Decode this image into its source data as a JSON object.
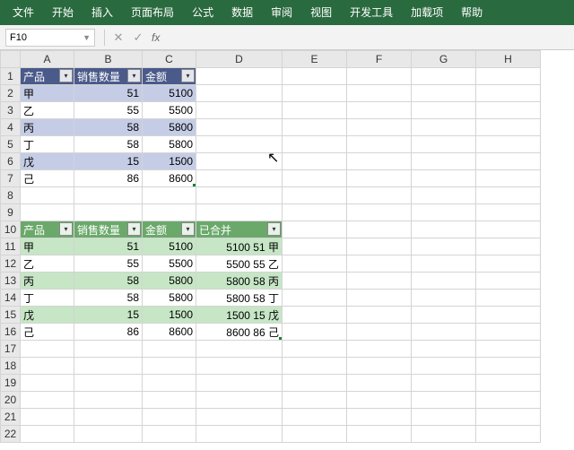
{
  "ribbon": {
    "tabs": [
      "文件",
      "开始",
      "插入",
      "页面布局",
      "公式",
      "数据",
      "审阅",
      "视图",
      "开发工具",
      "加载项",
      "帮助"
    ]
  },
  "nameBox": "F10",
  "formula": "",
  "colHeaders": [
    "A",
    "B",
    "C",
    "D",
    "E",
    "F",
    "G",
    "H"
  ],
  "rowCount": 22,
  "table1": {
    "startRow": 1,
    "headers": [
      "产品",
      "销售数量",
      "金额"
    ],
    "rows": [
      {
        "p": "甲",
        "q": 51,
        "a": 5100,
        "band": true
      },
      {
        "p": "乙",
        "q": 55,
        "a": 5500,
        "band": false
      },
      {
        "p": "丙",
        "q": 58,
        "a": 5800,
        "band": true
      },
      {
        "p": "丁",
        "q": 58,
        "a": 5800,
        "band": false
      },
      {
        "p": "戊",
        "q": 15,
        "a": 1500,
        "band": true
      },
      {
        "p": "己",
        "q": 86,
        "a": 8600,
        "band": false
      }
    ]
  },
  "table2": {
    "startRow": 10,
    "headers": [
      "产品",
      "销售数量",
      "金额",
      "已合并"
    ],
    "rows": [
      {
        "p": "甲",
        "q": 51,
        "a": 5100,
        "m": "5100 51 甲",
        "band": true
      },
      {
        "p": "乙",
        "q": 55,
        "a": 5500,
        "m": "5500 55 乙",
        "band": false
      },
      {
        "p": "丙",
        "q": 58,
        "a": 5800,
        "m": "5800 58 丙",
        "band": true
      },
      {
        "p": "丁",
        "q": 58,
        "a": 5800,
        "m": "5800 58 丁",
        "band": false
      },
      {
        "p": "戊",
        "q": 15,
        "a": 1500,
        "m": "1500 15 戊",
        "band": true
      },
      {
        "p": "己",
        "q": 86,
        "a": 8600,
        "m": "8600 86 己",
        "band": false
      }
    ]
  },
  "chart_data": null
}
